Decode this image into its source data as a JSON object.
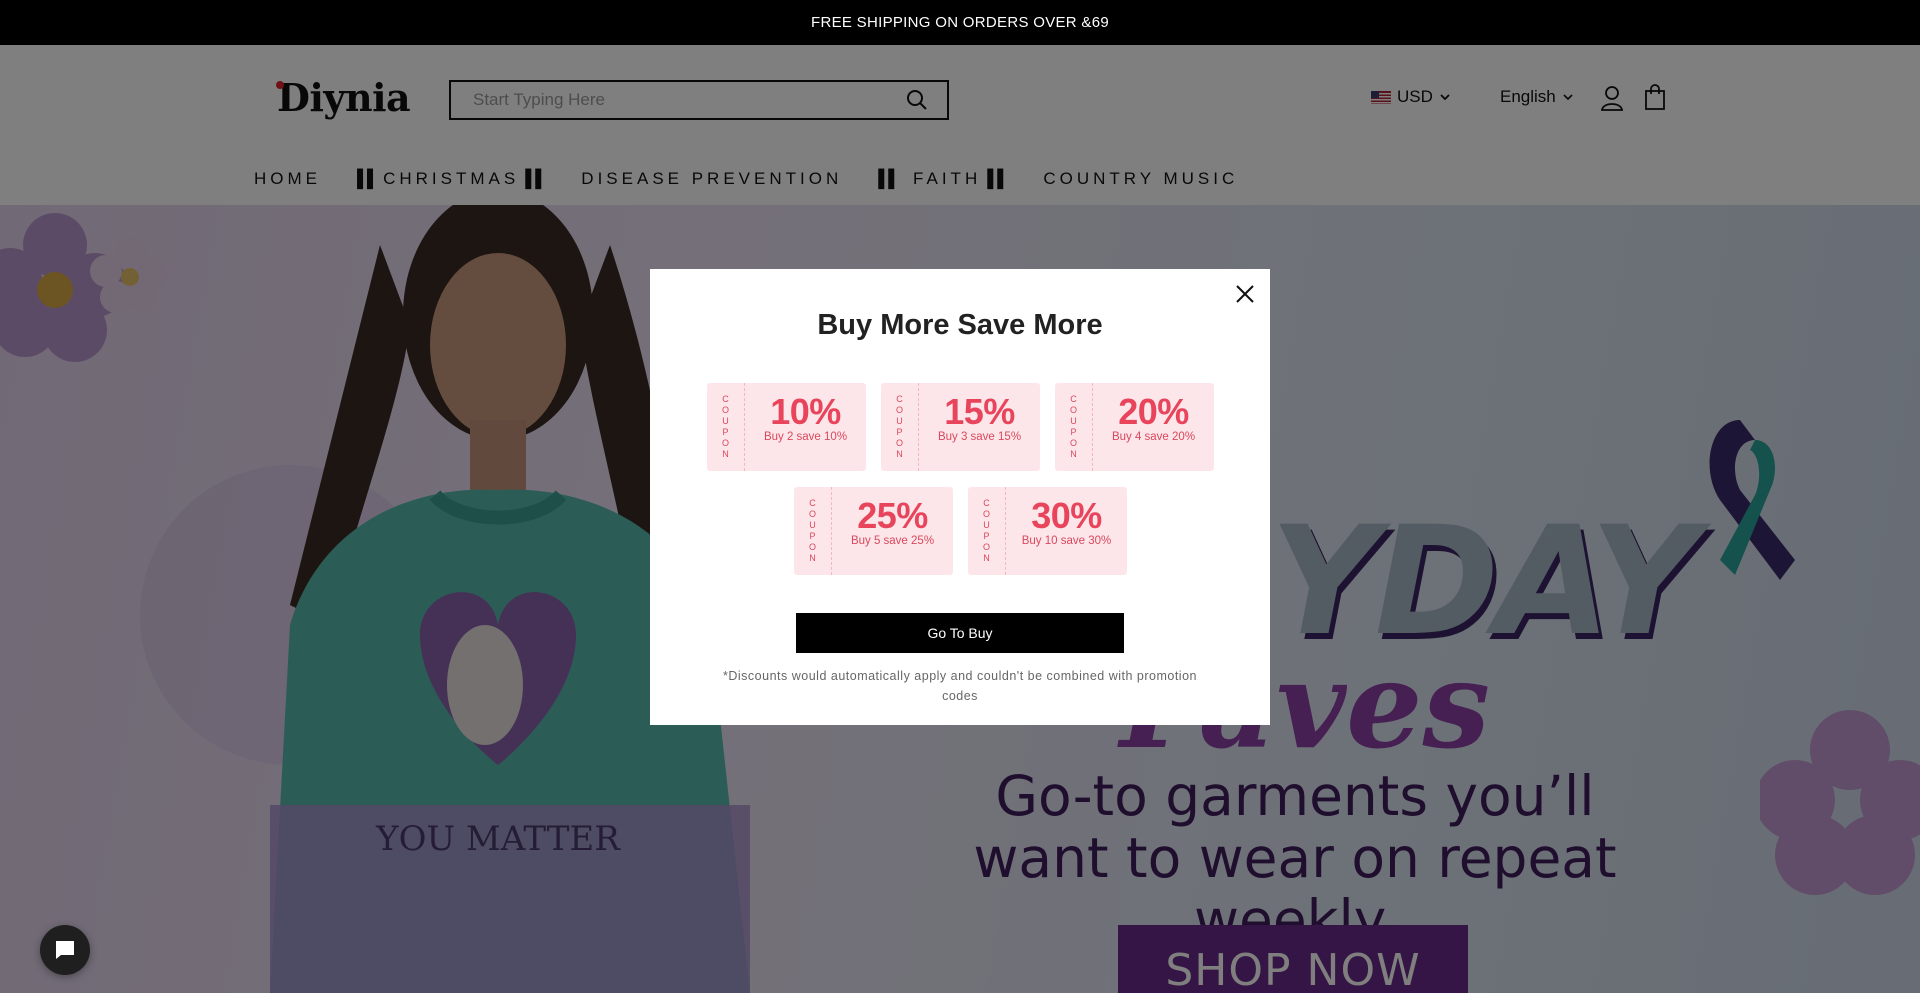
{
  "announcement": "FREE SHIPPING ON ORDERS OVER &69",
  "header": {
    "logo": "Diynia",
    "search_placeholder": "Start Typing Here",
    "currency": "USD",
    "language": "English"
  },
  "nav": [
    "HOME",
    "▐▌CHRISTMAS▐▌",
    "DISEASE PREVENTION",
    "▐▌ FAITH▐▌",
    "COUNTRY MUSIC"
  ],
  "hero": {
    "title": "YDAY",
    "script": "Faves",
    "subtitle_line1": "Go-to garments you’ll",
    "subtitle_line2": "want to wear on repeat weekly.",
    "cta": "SHOP NOW",
    "shirt_text": "YOU MATTER"
  },
  "modal": {
    "title": "Buy More Save More",
    "stub_letters": [
      "C",
      "O",
      "U",
      "P",
      "O",
      "N"
    ],
    "coupons": [
      {
        "percent": "10%",
        "desc": "Buy 2 save 10%"
      },
      {
        "percent": "15%",
        "desc": "Buy 3 save 15%"
      },
      {
        "percent": "20%",
        "desc": "Buy 4 save 20%"
      },
      {
        "percent": "25%",
        "desc": "Buy 5 save 25%"
      },
      {
        "percent": "30%",
        "desc": "Buy 10 save 30%"
      }
    ],
    "button": "Go To Buy",
    "note": "*Discounts would automatically apply and couldn't be combined with promotion codes"
  },
  "colors": {
    "coupon_bg": "#fde6ea",
    "coupon_text": "#e8455c",
    "hero_purple": "#6a2a8a",
    "overlay": "rgba(0,0,0,0.5)"
  }
}
